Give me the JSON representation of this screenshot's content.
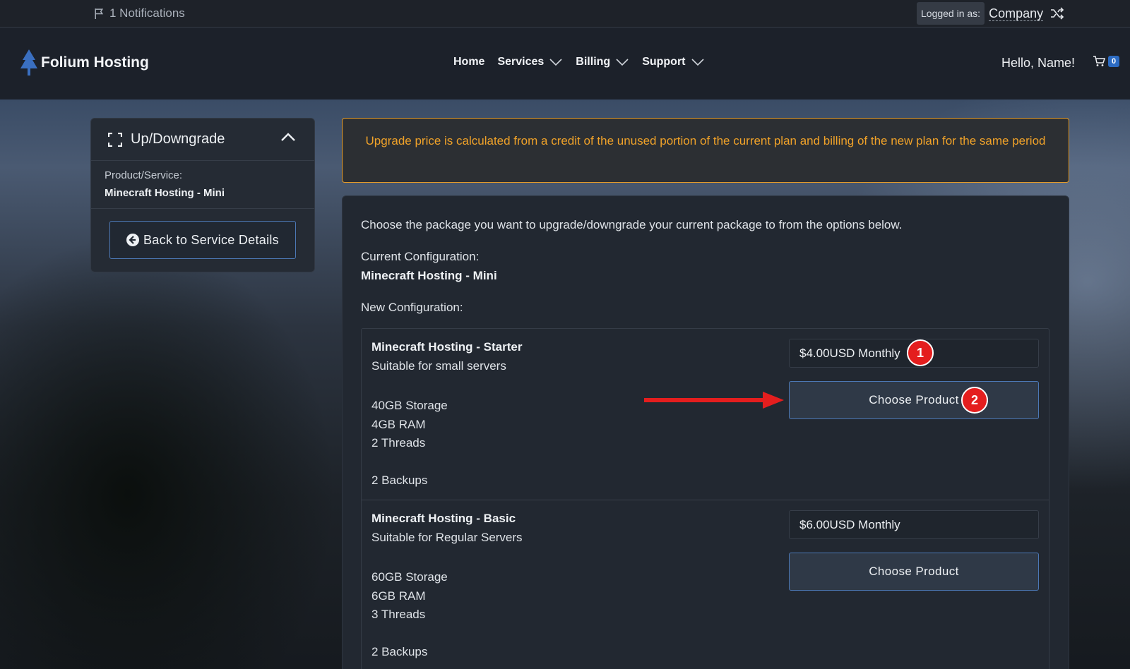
{
  "topbar": {
    "notifications": "1 Notifications",
    "logged_in_label": "Logged in as:",
    "company": "Company"
  },
  "navbar": {
    "brand": "Folium Hosting",
    "items": [
      {
        "label": "Home"
      },
      {
        "label": "Services"
      },
      {
        "label": "Billing"
      },
      {
        "label": "Support"
      }
    ],
    "greeting": "Hello, Name!",
    "cart_count": "0"
  },
  "sidebar": {
    "title": "Up/Downgrade",
    "product_label": "Product/Service:",
    "product_value": "Minecraft Hosting - Mini",
    "back_button": "Back to Service Details"
  },
  "alert": {
    "text": "Upgrade price is calculated from a credit of the unused portion of the current plan and billing of the new plan for the same period"
  },
  "main": {
    "intro": "Choose the package you want to upgrade/downgrade your current package to from the options below.",
    "current_label": "Current Configuration:",
    "current_value": "Minecraft Hosting - Mini",
    "new_label": "New Configuration:",
    "products": [
      {
        "name": "Minecraft Hosting - Starter",
        "description": "Suitable for small servers",
        "features": [
          "40GB Storage",
          "4GB RAM",
          "2 Threads",
          "",
          "2 Backups"
        ],
        "price": "$4.00USD Monthly",
        "button": "Choose Product"
      },
      {
        "name": "Minecraft Hosting - Basic",
        "description": "Suitable for Regular Servers",
        "features": [
          "60GB Storage",
          "6GB RAM",
          "3 Threads",
          "",
          "2 Backups"
        ],
        "price": "$6.00USD Monthly",
        "button": "Choose Product"
      }
    ]
  },
  "annotations": {
    "marker_1": "1",
    "marker_2": "2",
    "marker_color": "#e41e1e"
  },
  "colors": {
    "accent_blue": "#4c78b5",
    "alert_orange": "#f0a229"
  }
}
